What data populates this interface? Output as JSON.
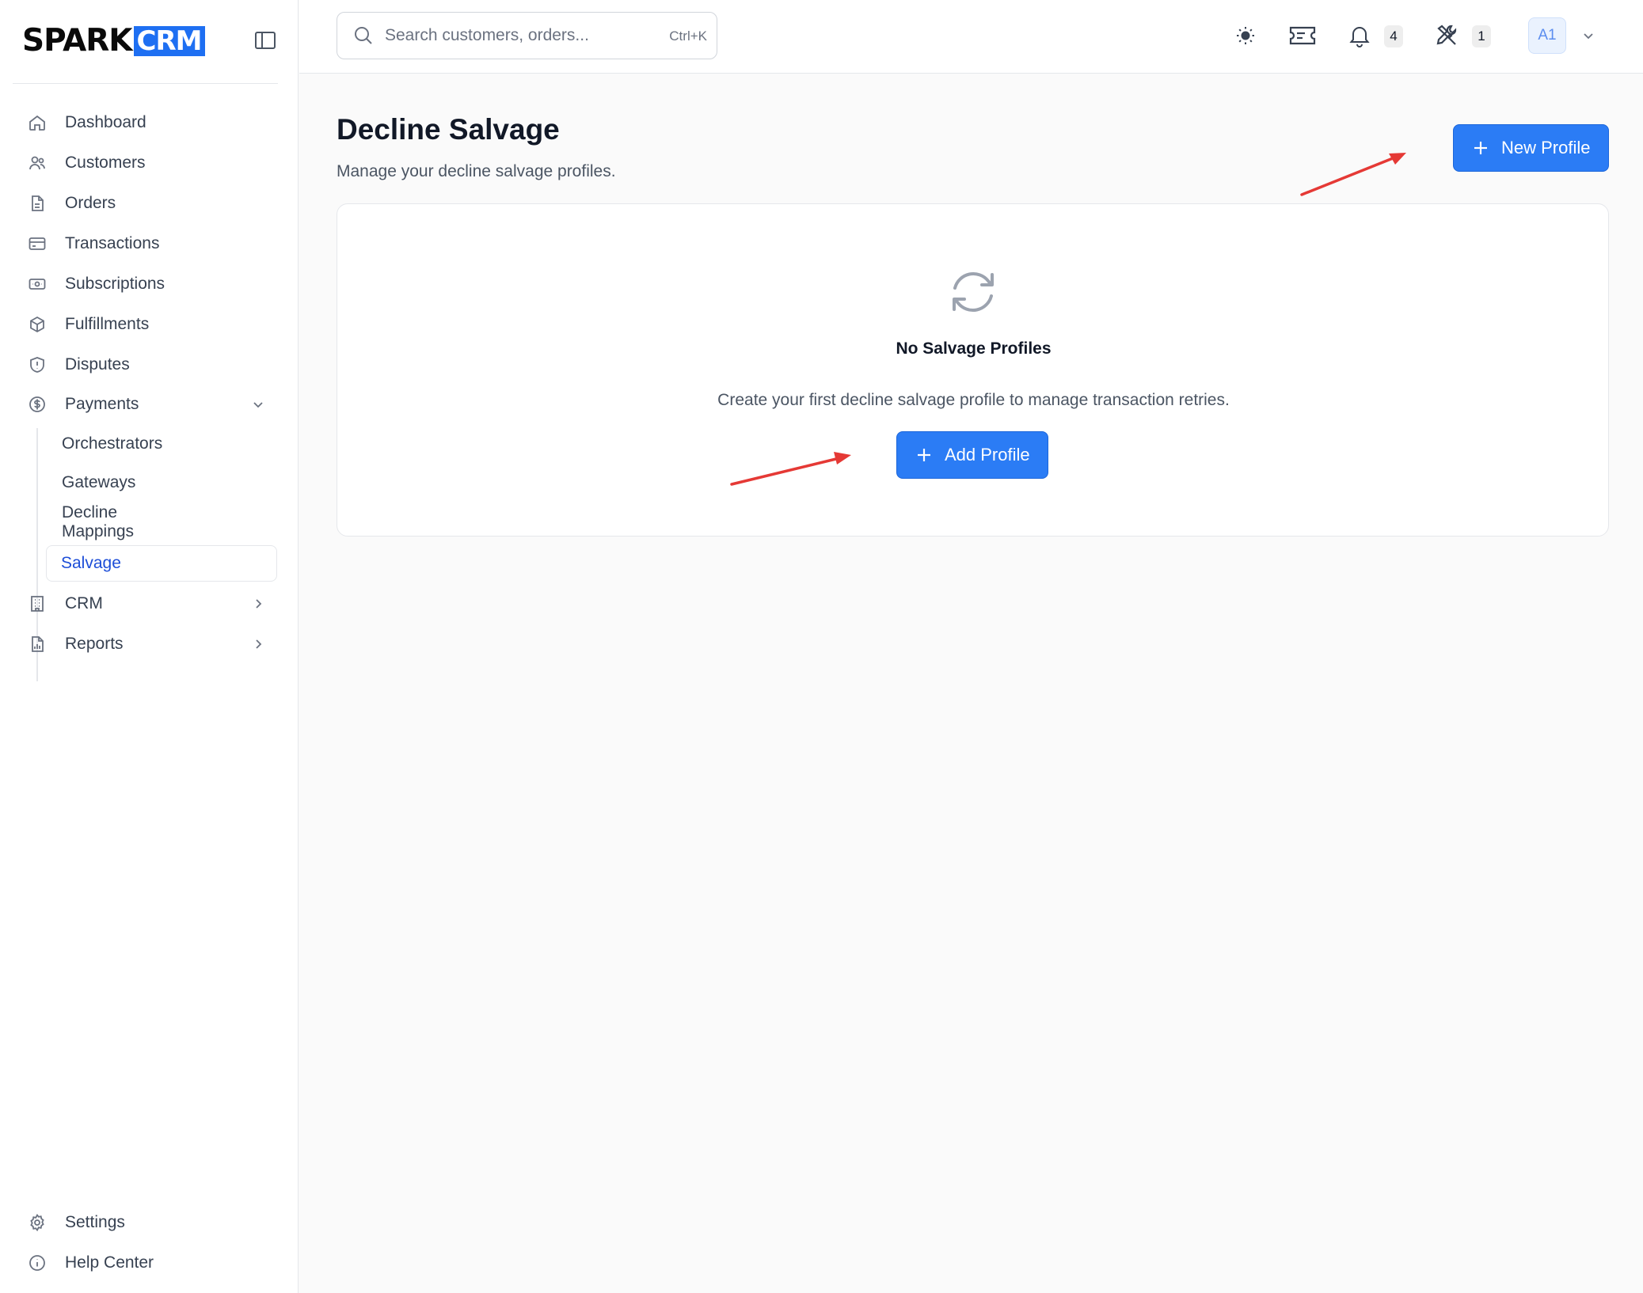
{
  "brand": {
    "word": "SPARK",
    "badge": "CRM"
  },
  "sidebar": {
    "items": [
      {
        "label": "Dashboard",
        "icon": "home-icon"
      },
      {
        "label": "Customers",
        "icon": "users-icon"
      },
      {
        "label": "Orders",
        "icon": "file-icon"
      },
      {
        "label": "Transactions",
        "icon": "credit-card-icon"
      },
      {
        "label": "Subscriptions",
        "icon": "banknote-icon"
      },
      {
        "label": "Fulfillments",
        "icon": "package-icon"
      },
      {
        "label": "Disputes",
        "icon": "shield-icon"
      },
      {
        "label": "Payments",
        "icon": "dollar-circle-icon"
      }
    ],
    "payments_sub": [
      "Orchestrators",
      "Gateways",
      "Decline Mappings",
      "Salvage"
    ],
    "after_items": [
      {
        "label": "CRM",
        "icon": "building-icon"
      },
      {
        "label": "Reports",
        "icon": "report-icon"
      }
    ],
    "bottom": [
      {
        "label": "Settings",
        "icon": "gear-icon"
      },
      {
        "label": "Help Center",
        "icon": "info-icon"
      }
    ]
  },
  "topbar": {
    "search_placeholder": "Search customers, orders...",
    "search_shortcut": "Ctrl+K",
    "notifications_count": "4",
    "tools_count": "1",
    "avatar_initials": "A1"
  },
  "main": {
    "title": "Decline Salvage",
    "subtitle": "Manage your decline salvage profiles.",
    "new_button": "New Profile",
    "empty": {
      "title": "No Salvage Profiles",
      "description": "Create your first decline salvage profile to manage transaction retries.",
      "add_button": "Add Profile"
    }
  },
  "colors": {
    "accent": "#2b7cf5",
    "annotation": "#e53935",
    "active_text": "#1d4ed8"
  }
}
